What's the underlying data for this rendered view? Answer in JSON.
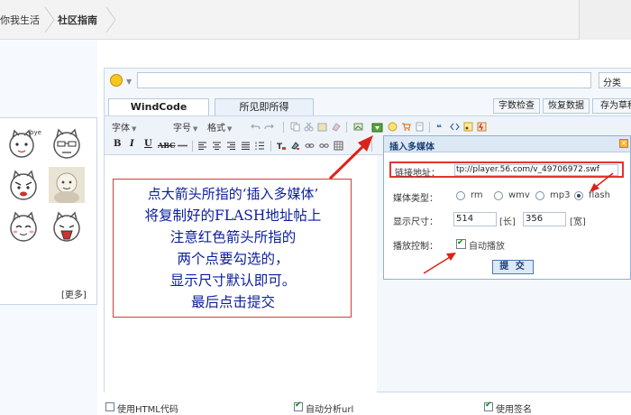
{
  "breadcrumb": {
    "home": "你我生活",
    "current": "社区指南"
  },
  "left_panel": {
    "more_label": "[更多]"
  },
  "editor": {
    "category_placeholder": "分类",
    "tabs": [
      {
        "label": "WindCode",
        "active": true
      },
      {
        "label": "所见即所得",
        "active": false
      }
    ],
    "actions": [
      "字数检查",
      "恢复数据",
      "存为草稿"
    ],
    "toolbar": {
      "font_label": "字体",
      "size_label": "字号",
      "format_label": "格式",
      "bold": "B",
      "italic": "I",
      "underline": "U",
      "strike": "ABC"
    }
  },
  "media_dialog": {
    "title": "插入多媒体",
    "url_label": "链接地址：",
    "url_value": "tp://player.56.com/v_49706972.swf",
    "type_label": "媒体类型：",
    "types": [
      "rm",
      "wmv",
      "mp3",
      "flash"
    ],
    "selected_type": "flash",
    "size_label": "显示尺寸：",
    "width": "514",
    "width_unit": "[长]",
    "height": "356",
    "height_unit": "[宽]",
    "control_label": "播放控制：",
    "autoplay_label": "自动播放",
    "autoplay_checked": true,
    "submit_label": "提 交"
  },
  "annotation": {
    "lines": [
      "点大箭头所指的‘插入多媒体’",
      "将复制好的FLASH地址帖上",
      "注意红色箭头所指的",
      "两个点要勾选的，",
      "显示尺寸默认即可。",
      "最后点击提交"
    ]
  },
  "options": {
    "html_code": "使用HTML代码",
    "auto_url": "自动分析url",
    "signature": "使用签名"
  },
  "colors": {
    "annotation_text": "#0b1e9c",
    "arrow_red": "#d9241b",
    "dialog_border": "#8fb0d8"
  }
}
